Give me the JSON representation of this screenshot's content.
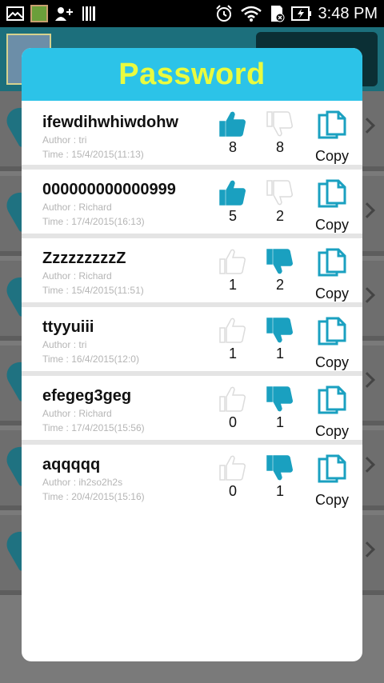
{
  "status_bar": {
    "time": "3:48 PM",
    "icons": [
      "mail-icon",
      "app-thumbnail-icon",
      "add-contact-icon",
      "barcode-icon",
      "alarm-icon",
      "wifi-icon",
      "sd-card-icon",
      "battery-charging-icon"
    ]
  },
  "dialog": {
    "title": "Password",
    "title_color": "#e9fb3f",
    "header_color": "#2cc3e8",
    "accent_color": "#1aa0c0",
    "copy_label": "Copy",
    "items": [
      {
        "password": "ifewdihwhiwdohw",
        "author": "Author : tri",
        "time": "Time : 15/4/2015(11:13)",
        "likes": "8",
        "dislikes": "8",
        "liked": true,
        "disliked": false
      },
      {
        "password": "000000000000999",
        "author": "Author : Richard",
        "time": "Time : 17/4/2015(16:13)",
        "likes": "5",
        "dislikes": "2",
        "liked": true,
        "disliked": false
      },
      {
        "password": "ZzzzzzzzzZ",
        "author": "Author : Richard",
        "time": "Time : 15/4/2015(11:51)",
        "likes": "1",
        "dislikes": "2",
        "liked": false,
        "disliked": true
      },
      {
        "password": "ttyyuiii",
        "author": "Author : tri",
        "time": "Time : 16/4/2015(12:0)",
        "likes": "1",
        "dislikes": "1",
        "liked": false,
        "disliked": true
      },
      {
        "password": "efegeg3geg",
        "author": "Author : Richard",
        "time": "Time : 17/4/2015(15:56)",
        "likes": "0",
        "dislikes": "1",
        "liked": false,
        "disliked": true
      },
      {
        "password": "aqqqqq",
        "author": "Author : ih2so2h2s",
        "time": "Time : 20/4/2015(15:16)",
        "likes": "0",
        "dislikes": "1",
        "liked": false,
        "disliked": true
      }
    ]
  }
}
